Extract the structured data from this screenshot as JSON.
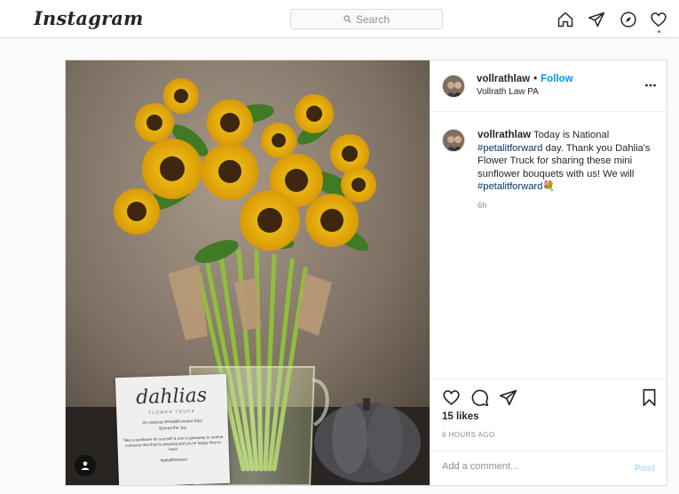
{
  "topbar": {
    "logo": "Instagram",
    "search_placeholder": "Search",
    "icons": [
      "home-icon",
      "direct-icon",
      "explore-icon",
      "activity-heart-icon"
    ]
  },
  "post": {
    "username": "vollrathlaw",
    "separator": "•",
    "follow_label": "Follow",
    "location": "Vollrath Law PA",
    "caption": {
      "username": "vollrathlaw",
      "text_1": " Today is National ",
      "hashtag_1": "#petalitforward",
      "text_2": " day. Thank you Dahlia's Flower Truck for sharing these mini sunflower bouquets with us! We will ",
      "hashtag_2": "#petalitforward",
      "emoji": "💐",
      "time": "6h"
    },
    "likes": "15 likes",
    "timestamp": "6 HOURS AGO",
    "comment_placeholder": "Add a comment...",
    "post_label": "Post",
    "photo_card": {
      "brand": "dahlias",
      "subtitle": "FLOWER TRUCK",
      "line1": "It's national #PetalItForward Day!",
      "line2": "Spread the Joy",
      "body": "Take a sunflower for yourself & one to giveaway to remind someone that they're amazing and you're happy they're here!",
      "hashtag": "#petalitforward"
    }
  },
  "colors": {
    "link": "#0095f6",
    "hashtag": "#00376b",
    "border": "#dbdbdb",
    "notification": "#ed4956"
  }
}
